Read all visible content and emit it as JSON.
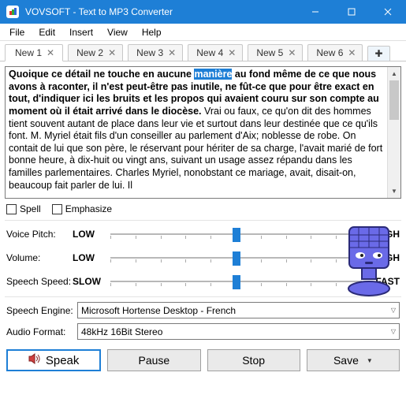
{
  "window": {
    "title": "VOVSOFT - Text to MP3 Converter"
  },
  "menu": [
    "File",
    "Edit",
    "Insert",
    "View",
    "Help"
  ],
  "tabs": [
    {
      "label": "New 1",
      "active": true
    },
    {
      "label": "New 2",
      "active": false
    },
    {
      "label": "New 3",
      "active": false
    },
    {
      "label": "New 4",
      "active": false
    },
    {
      "label": "New 5",
      "active": false
    },
    {
      "label": "New 6",
      "active": false
    }
  ],
  "text": {
    "bold_prefix": "Quoique ce détail ne touche en aucune ",
    "highlight": "manière",
    "bold_rest": " au fond même de ce que nous avons à raconter, il n'est peut-être pas inutile, ne fût-ce que pour être exact en tout, d'indiquer ici les bruits et les propos qui avaient couru sur son compte au moment où il était arrivé dans le diocèse.",
    "normal": " Vrai ou faux, ce qu'on dit des hommes tient souvent autant de place dans leur vie et surtout dans leur destinée que ce qu'ils font. M. Myriel était fils d'un conseiller au parlement d'Aix; noblesse de robe. On contait de lui que son père, le réservant pour hériter de sa charge, l'avait marié de fort bonne heure, à dix-huit ou vingt ans, suivant un usage assez répandu dans les familles parlementaires. Charles Myriel, nonobstant ce mariage, avait, disait-on, beaucoup fait parler de lui. Il"
  },
  "checkboxes": {
    "spell": "Spell",
    "emphasize": "Emphasize"
  },
  "sliders": {
    "pitch": {
      "label": "Voice Pitch:",
      "min": "LOW",
      "max": "HIGH"
    },
    "volume": {
      "label": "Volume:",
      "min": "LOW",
      "max": "HIGH"
    },
    "speed": {
      "label": "Speech Speed:",
      "min": "SLOW",
      "max": "FAST"
    }
  },
  "selects": {
    "engine": {
      "label": "Speech Engine:",
      "value": "Microsoft Hortense Desktop - French"
    },
    "format": {
      "label": "Audio Format:",
      "value": "48kHz 16Bit Stereo"
    }
  },
  "buttons": {
    "speak": "Speak",
    "pause": "Pause",
    "stop": "Stop",
    "save": "Save"
  }
}
